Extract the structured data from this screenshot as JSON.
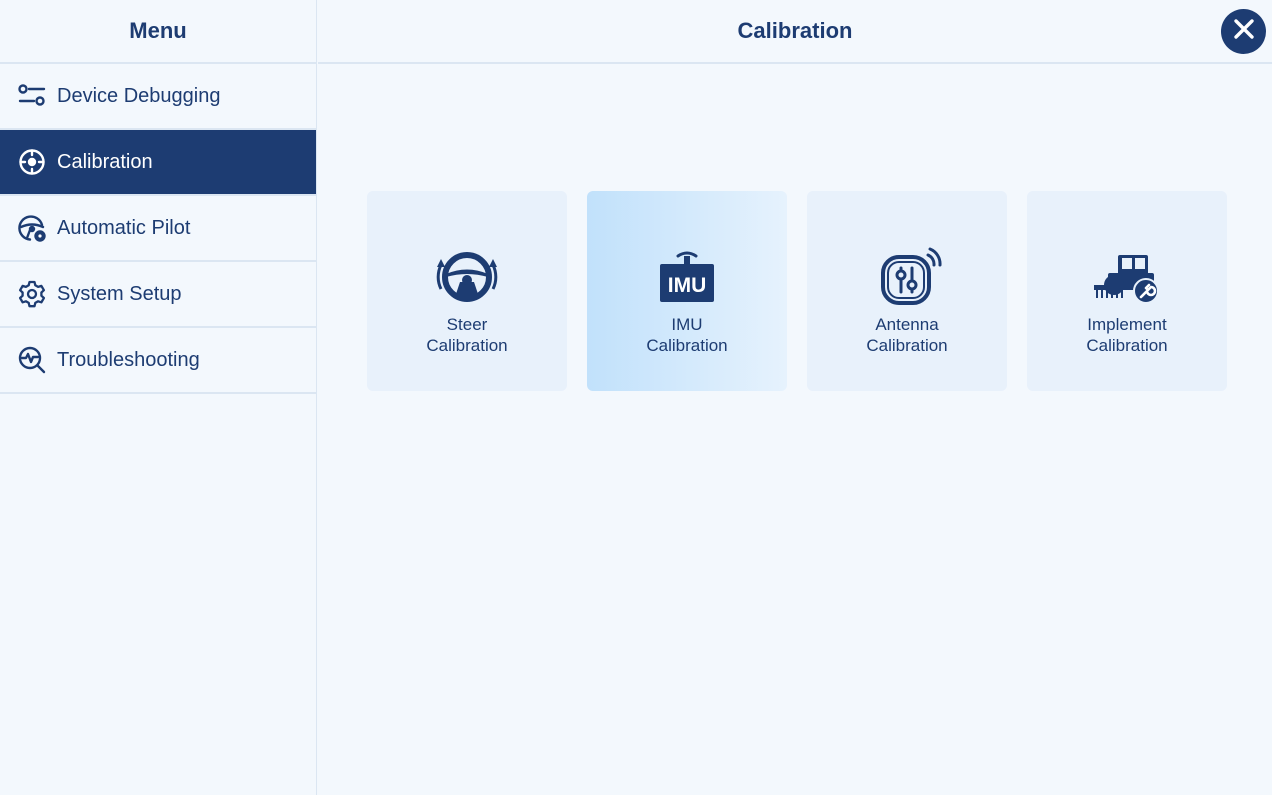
{
  "sidebar": {
    "title": "Menu",
    "items": [
      {
        "label": "Device Debugging",
        "icon": "sliders-icon"
      },
      {
        "label": "Calibration",
        "icon": "crosshair-icon",
        "active": true
      },
      {
        "label": "Automatic Pilot",
        "icon": "steering-wheel-gear-icon"
      },
      {
        "label": "System Setup",
        "icon": "gear-icon"
      },
      {
        "label": "Troubleshooting",
        "icon": "diagnostic-search-icon"
      }
    ]
  },
  "header": {
    "title": "Calibration",
    "close_icon": "close-icon"
  },
  "cards": [
    {
      "line1": "Steer",
      "line2": "Calibration",
      "icon": "steering-wheel-icon"
    },
    {
      "line1": "IMU",
      "line2": "Calibration",
      "icon": "imu-icon",
      "icon_text": "IMU",
      "active": true
    },
    {
      "line1": "Antenna",
      "line2": "Calibration",
      "icon": "antenna-icon"
    },
    {
      "line1": "Implement",
      "line2": "Calibration",
      "icon": "tractor-wrench-icon"
    }
  ],
  "colors": {
    "primary": "#1d3c72",
    "background": "#f3f8fd",
    "card": "#e8f1fb",
    "card_active": "#c1e1fb",
    "divider": "#dbe6f2"
  }
}
